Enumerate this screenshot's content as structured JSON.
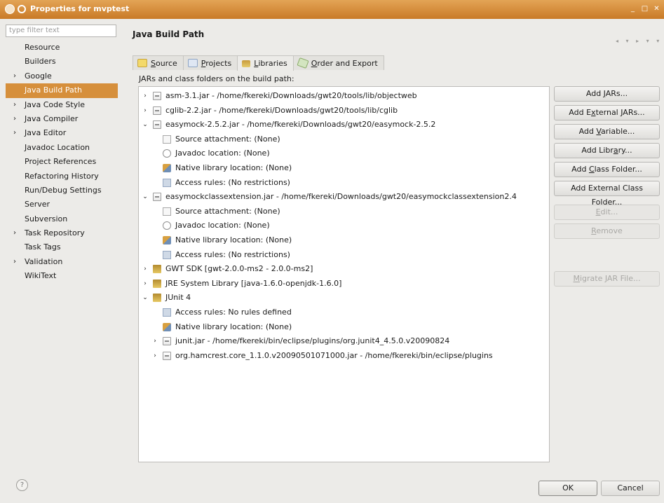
{
  "window": {
    "title": "Properties for mvptest",
    "controls": [
      "_",
      "□",
      "✕"
    ]
  },
  "filter": {
    "placeholder": "type filter text"
  },
  "sidebar": {
    "items": [
      {
        "label": "Resource",
        "expandable": false
      },
      {
        "label": "Builders",
        "expandable": false
      },
      {
        "label": "Google",
        "expandable": true
      },
      {
        "label": "Java Build Path",
        "expandable": false,
        "selected": true
      },
      {
        "label": "Java Code Style",
        "expandable": true
      },
      {
        "label": "Java Compiler",
        "expandable": true
      },
      {
        "label": "Java Editor",
        "expandable": true
      },
      {
        "label": "Javadoc Location",
        "expandable": false
      },
      {
        "label": "Project References",
        "expandable": false
      },
      {
        "label": "Refactoring History",
        "expandable": false
      },
      {
        "label": "Run/Debug Settings",
        "expandable": false
      },
      {
        "label": "Server",
        "expandable": false
      },
      {
        "label": "Subversion",
        "expandable": false
      },
      {
        "label": "Task Repository",
        "expandable": true
      },
      {
        "label": "Task Tags",
        "expandable": false
      },
      {
        "label": "Validation",
        "expandable": true
      },
      {
        "label": "WikiText",
        "expandable": false
      }
    ]
  },
  "main": {
    "heading": "Java Build Path",
    "nav_arrows": "◂ ▾ ▸ ▾ ▾",
    "tabs": [
      {
        "pre": "",
        "u": "S",
        "post": "ource",
        "icon": "source-folder-icon",
        "iconclass": "src",
        "active": false
      },
      {
        "pre": "",
        "u": "P",
        "post": "rojects",
        "icon": "projects-icon",
        "iconclass": "prj",
        "active": false
      },
      {
        "pre": "",
        "u": "L",
        "post": "ibraries",
        "icon": "libraries-icon",
        "iconclass": "lib",
        "active": true
      },
      {
        "pre": "",
        "u": "O",
        "post": "rder and Export",
        "icon": "order-export-icon",
        "iconclass": "ord",
        "active": false
      }
    ],
    "description": "JARs and class folders on the build path:",
    "tree": [
      {
        "indent": 0,
        "arrow": "›",
        "icon": "jar-icon",
        "iconclass": "ic-jar",
        "text": "asm-3.1.jar - /home/fkereki/Downloads/gwt20/tools/lib/objectweb"
      },
      {
        "indent": 0,
        "arrow": "›",
        "icon": "jar-icon",
        "iconclass": "ic-jar",
        "text": "cglib-2.2.jar - /home/fkereki/Downloads/gwt20/tools/lib/cglib"
      },
      {
        "indent": 0,
        "arrow": "⌄",
        "icon": "jar-icon",
        "iconclass": "ic-jar",
        "text": "easymock-2.5.2.jar - /home/fkereki/Downloads/gwt20/easymock-2.5.2"
      },
      {
        "indent": 1,
        "arrow": "",
        "icon": "source-attachment-icon",
        "iconclass": "ic-src",
        "text": "Source attachment: (None)"
      },
      {
        "indent": 1,
        "arrow": "",
        "icon": "javadoc-icon",
        "iconclass": "ic-doc",
        "text": "Javadoc location: (None)"
      },
      {
        "indent": 1,
        "arrow": "",
        "icon": "native-library-icon",
        "iconclass": "ic-nat",
        "text": "Native library location: (None)"
      },
      {
        "indent": 1,
        "arrow": "",
        "icon": "access-rules-icon",
        "iconclass": "ic-acc",
        "text": "Access rules: (No restrictions)"
      },
      {
        "indent": 0,
        "arrow": "⌄",
        "icon": "jar-icon",
        "iconclass": "ic-jar",
        "text": "easymockclassextension.jar - /home/fkereki/Downloads/gwt20/easymockclassextension2.4"
      },
      {
        "indent": 1,
        "arrow": "",
        "icon": "source-attachment-icon",
        "iconclass": "ic-src",
        "text": "Source attachment: (None)"
      },
      {
        "indent": 1,
        "arrow": "",
        "icon": "javadoc-icon",
        "iconclass": "ic-doc",
        "text": "Javadoc location: (None)"
      },
      {
        "indent": 1,
        "arrow": "",
        "icon": "native-library-icon",
        "iconclass": "ic-nat",
        "text": "Native library location: (None)"
      },
      {
        "indent": 1,
        "arrow": "",
        "icon": "access-rules-icon",
        "iconclass": "ic-acc",
        "text": "Access rules: (No restrictions)"
      },
      {
        "indent": 0,
        "arrow": "›",
        "icon": "library-icon",
        "iconclass": "ic-lib",
        "text": "GWT SDK [gwt-2.0.0-ms2 - 2.0.0-ms2]"
      },
      {
        "indent": 0,
        "arrow": "›",
        "icon": "library-icon",
        "iconclass": "ic-lib",
        "text": "JRE System Library [java-1.6.0-openjdk-1.6.0]"
      },
      {
        "indent": 0,
        "arrow": "⌄",
        "icon": "library-icon",
        "iconclass": "ic-lib",
        "text": "JUnit 4"
      },
      {
        "indent": 1,
        "arrow": "",
        "icon": "access-rules-icon",
        "iconclass": "ic-acc",
        "text": "Access rules: No rules defined"
      },
      {
        "indent": 1,
        "arrow": "",
        "icon": "native-library-icon",
        "iconclass": "ic-nat",
        "text": "Native library location: (None)"
      },
      {
        "indent": 1,
        "arrow": "›",
        "icon": "jar-icon",
        "iconclass": "ic-jar",
        "text": "junit.jar - /home/fkereki/bin/eclipse/plugins/org.junit4_4.5.0.v20090824"
      },
      {
        "indent": 1,
        "arrow": "›",
        "icon": "jar-icon",
        "iconclass": "ic-jar",
        "text": "org.hamcrest.core_1.1.0.v20090501071000.jar - /home/fkereki/bin/eclipse/plugins"
      }
    ],
    "buttons": [
      {
        "pre": "Add ",
        "u": "J",
        "post": "ARs...",
        "disabled": false,
        "name": "add-jars-button"
      },
      {
        "pre": "Add E",
        "u": "x",
        "post": "ternal JARs...",
        "disabled": false,
        "name": "add-external-jars-button"
      },
      {
        "pre": "Add ",
        "u": "V",
        "post": "ariable...",
        "disabled": false,
        "name": "add-variable-button"
      },
      {
        "pre": "Add Libr",
        "u": "a",
        "post": "ry...",
        "disabled": false,
        "name": "add-library-button"
      },
      {
        "pre": "Add ",
        "u": "C",
        "post": "lass Folder...",
        "disabled": false,
        "name": "add-class-folder-button"
      },
      {
        "pre": "Add External Class Fol",
        "u": "d",
        "post": "er...",
        "disabled": false,
        "name": "add-external-class-folder-button"
      },
      {
        "pre": "",
        "u": "E",
        "post": "dit...",
        "disabled": true,
        "name": "edit-button"
      },
      {
        "pre": "",
        "u": "R",
        "post": "emove",
        "disabled": true,
        "name": "remove-button"
      },
      {
        "pre": "",
        "u": "M",
        "post": "igrate JAR File...",
        "disabled": true,
        "name": "migrate-jar-file-button"
      }
    ]
  },
  "footer": {
    "help": "?",
    "ok": "OK",
    "cancel": "Cancel"
  }
}
